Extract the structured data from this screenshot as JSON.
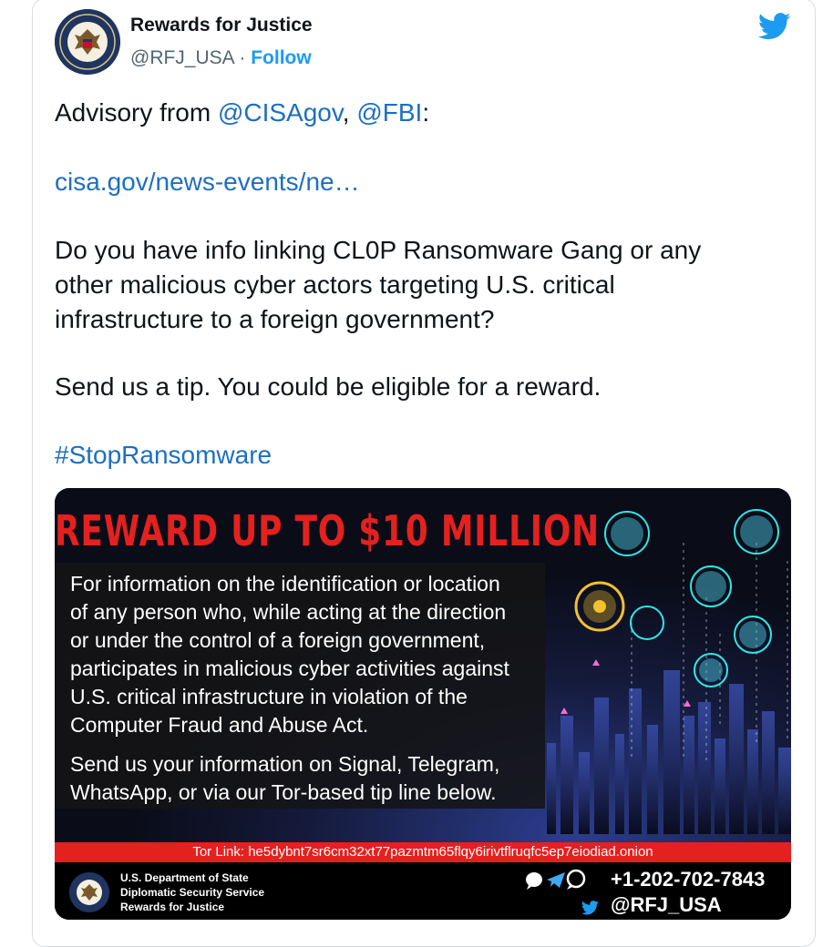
{
  "header": {
    "display_name": "Rewards for Justice",
    "handle": "@RFJ_USA",
    "separator": "·",
    "follow_label": "Follow"
  },
  "tweet": {
    "line1_prefix": "Advisory from ",
    "mention1": "@CISAgov",
    "line1_comma": ", ",
    "mention2": "@FBI",
    "line1_suffix": ":",
    "link": "cisa.gov/news-events/ne…",
    "para2_line1": "Do you have info linking CL0P Ransomware Gang or any",
    "para2_line2": "other malicious cyber actors targeting U.S. critical",
    "para2_line3": "infrastructure to a foreign government?",
    "para3": "Send us a tip. You could be eligible for a reward.",
    "hashtag": "#StopRansomware"
  },
  "media": {
    "headline": "REWARD UP TO $10 MILLION",
    "info_lines": [
      "For information on the identification or location",
      "of any person who, while acting at the direction",
      "or under the control of a foreign government,",
      "participates in malicious cyber activities against",
      "U.S. critical infrastructure in violation of the",
      "Computer Fraud and Abuse Act."
    ],
    "send_lines": [
      "Send us your information on Signal, Telegram,",
      "WhatsApp, or via our Tor-based tip line below."
    ],
    "tor_link": "Tor Link: he5dybnt7sr6cm32xt77pazmtm65flqy6irivtflruqfc5ep7eiodiad.onion",
    "dept_lines": [
      "U.S. Department of State",
      "Diplomatic Security Service",
      "Rewards for Justice"
    ],
    "phone": "+1-202-702-7843",
    "twitter_handle": "@RFJ_USA"
  },
  "colors": {
    "link": "#1d6fc2",
    "twitter_blue": "#1d9bf0",
    "headline_red": "#e3211f"
  },
  "icons": [
    "state-department-seal-icon",
    "twitter-bird-icon",
    "signal-icon",
    "telegram-icon",
    "whatsapp-icon"
  ]
}
